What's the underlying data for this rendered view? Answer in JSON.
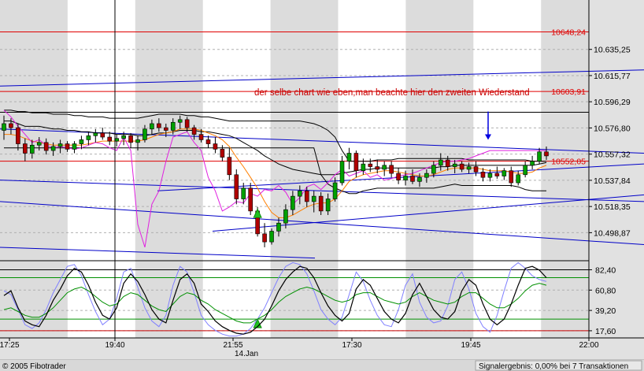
{
  "chart_data": {
    "type": "candlestick",
    "title": "",
    "annotation": "der selbe chart wie eben,man beachte hier den zweiten Wiederstand",
    "price_panel": {
      "ylim": [
        10478,
        10672
      ],
      "y_ticks": [
        "10.635,25",
        "10.615,77",
        "10.596,29",
        "10.576,80",
        "10.557,32",
        "10.537,84",
        "10.518,35",
        "10.498,87"
      ],
      "y_tick_values": [
        10635.25,
        10615.77,
        10596.29,
        10576.8,
        10557.32,
        10537.84,
        10518.35,
        10498.87
      ],
      "horizontal_levels": [
        {
          "label": "10648,24",
          "value": 10648.24,
          "color": "#e00000"
        },
        {
          "label": "10603,91",
          "value": 10603.91,
          "color": "#e00000"
        },
        {
          "label": "10552,05",
          "value": 10552.05,
          "color": "#e00000"
        },
        {
          "label": "",
          "value": 10588.5,
          "color": "#000000"
        }
      ],
      "candles_ohlc": [
        [
          10575,
          10586,
          10568,
          10580
        ],
        [
          10580,
          10584,
          10572,
          10577
        ],
        [
          10577,
          10580,
          10560,
          10565
        ],
        [
          10565,
          10569,
          10552,
          10558
        ],
        [
          10558,
          10568,
          10554,
          10564
        ],
        [
          10564,
          10570,
          10560,
          10566
        ],
        [
          10566,
          10569,
          10557,
          10560
        ],
        [
          10560,
          10566,
          10556,
          10563
        ],
        [
          10563,
          10568,
          10558,
          10565
        ],
        [
          10565,
          10567,
          10559,
          10561
        ],
        [
          10561,
          10567,
          10558,
          10565
        ],
        [
          10565,
          10571,
          10561,
          10568
        ],
        [
          10568,
          10574,
          10564,
          10571
        ],
        [
          10571,
          10576,
          10566,
          10573
        ],
        [
          10573,
          10577,
          10568,
          10570
        ],
        [
          10570,
          10574,
          10564,
          10567
        ],
        [
          10567,
          10572,
          10563,
          10569
        ],
        [
          10569,
          10574,
          10564,
          10571
        ],
        [
          10571,
          10573,
          10562,
          10566
        ],
        [
          10566,
          10571,
          10560,
          10568
        ],
        [
          10568,
          10579,
          10566,
          10576
        ],
        [
          10576,
          10583,
          10572,
          10580
        ],
        [
          10580,
          10584,
          10574,
          10577
        ],
        [
          10577,
          10580,
          10570,
          10575
        ],
        [
          10575,
          10584,
          10572,
          10581
        ],
        [
          10581,
          10586,
          10576,
          10583
        ],
        [
          10583,
          10585,
          10574,
          10577
        ],
        [
          10577,
          10579,
          10568,
          10572
        ],
        [
          10572,
          10576,
          10566,
          10568
        ],
        [
          10568,
          10571,
          10562,
          10565
        ],
        [
          10565,
          10570,
          10558,
          10561
        ],
        [
          10561,
          10564,
          10552,
          10555
        ],
        [
          10555,
          10562,
          10538,
          10542
        ],
        [
          10542,
          10546,
          10520,
          10524
        ],
        [
          10524,
          10536,
          10520,
          10532
        ],
        [
          10532,
          10536,
          10512,
          10515
        ],
        [
          10515,
          10518,
          10496,
          10498
        ],
        [
          10498,
          10506,
          10488,
          10492
        ],
        [
          10492,
          10502,
          10490,
          10500
        ],
        [
          10500,
          10510,
          10496,
          10506
        ],
        [
          10506,
          10520,
          10502,
          10516
        ],
        [
          10516,
          10530,
          10512,
          10526
        ],
        [
          10526,
          10534,
          10520,
          10530
        ],
        [
          10530,
          10533,
          10518,
          10522
        ],
        [
          10522,
          10530,
          10514,
          10526
        ],
        [
          10526,
          10529,
          10512,
          10515
        ],
        [
          10515,
          10528,
          10512,
          10524
        ],
        [
          10524,
          10540,
          10522,
          10536
        ],
        [
          10536,
          10556,
          10534,
          10552
        ],
        [
          10552,
          10562,
          10546,
          10558
        ],
        [
          10558,
          10560,
          10540,
          10545
        ],
        [
          10545,
          10554,
          10542,
          10550
        ],
        [
          10550,
          10554,
          10544,
          10548
        ],
        [
          10548,
          10553,
          10543,
          10546
        ],
        [
          10546,
          10552,
          10541,
          10549
        ],
        [
          10549,
          10552,
          10540,
          10543
        ],
        [
          10543,
          10547,
          10535,
          10538
        ],
        [
          10538,
          10545,
          10534,
          10541
        ],
        [
          10541,
          10546,
          10535,
          10537
        ],
        [
          10537,
          10543,
          10533,
          10540
        ],
        [
          10540,
          10546,
          10536,
          10543
        ],
        [
          10543,
          10552,
          10540,
          10549
        ],
        [
          10549,
          10558,
          10545,
          10553
        ],
        [
          10553,
          10556,
          10545,
          10548
        ],
        [
          10548,
          10553,
          10543,
          10550
        ],
        [
          10550,
          10552,
          10544,
          10546
        ],
        [
          10546,
          10551,
          10543,
          10548
        ],
        [
          10548,
          10552,
          10541,
          10544
        ],
        [
          10544,
          10547,
          10537,
          10540
        ],
        [
          10540,
          10546,
          10537,
          10543
        ],
        [
          10543,
          10548,
          10539,
          10541
        ],
        [
          10541,
          10547,
          10538,
          10545
        ],
        [
          10545,
          10548,
          10533,
          10536
        ],
        [
          10536,
          10545,
          10534,
          10542
        ],
        [
          10542,
          10552,
          10540,
          10549
        ],
        [
          10549,
          10556,
          10546,
          10552
        ],
        [
          10552,
          10562,
          10550,
          10559
        ],
        [
          10559,
          10563,
          10553,
          10556
        ]
      ],
      "moving_average_black": [
        10582,
        10582,
        10580,
        10578,
        10578,
        10578,
        10577,
        10576,
        10576,
        10575,
        10575,
        10574,
        10574,
        10573,
        10573,
        10573,
        10572,
        10572,
        10572,
        10571,
        10571,
        10572,
        10573,
        10573,
        10574,
        10575,
        10575,
        10575,
        10574,
        10574,
        10573,
        10572,
        10571,
        10569,
        10566,
        10563,
        10560,
        10556,
        10553,
        10550,
        10548,
        10546,
        10545,
        10544,
        10543,
        10542,
        10542,
        10542,
        10543,
        10544,
        10545,
        10546,
        10546,
        10547,
        10547,
        10547,
        10547,
        10547,
        10547,
        10547,
        10547,
        10547,
        10548,
        10548,
        10549,
        10549,
        10549,
        10549,
        10549,
        10549,
        10549,
        10549,
        10549,
        10549,
        10549,
        10549,
        10550,
        10551
      ],
      "envelope_black_upper": [
        10590,
        10590,
        10589,
        10589,
        10588,
        10588,
        10588,
        10587,
        10587,
        10587,
        10586,
        10586,
        10585,
        10585,
        10585,
        10584,
        10584,
        10584,
        10584,
        10584,
        10585,
        10586,
        10587,
        10587,
        10587,
        10587,
        10586,
        10586,
        10585,
        10585,
        10584,
        10583,
        10582,
        10582,
        10582,
        10582,
        10582,
        10582,
        10582,
        10582,
        10582,
        10582,
        10582,
        10581,
        10580,
        10578,
        10575,
        10570,
        10560,
        10552,
        10552,
        10552,
        10552,
        10553,
        10553,
        10553,
        10554,
        10554,
        10554,
        10554,
        10554,
        10554,
        10554,
        10554,
        10554,
        10554,
        10553,
        10553,
        10553,
        10553,
        10553,
        10553,
        10553,
        10553,
        10553,
        10552,
        10552,
        10552
      ],
      "envelope_black_lower": [
        10562,
        10562,
        10562,
        10562,
        10562,
        10562,
        10562,
        10562,
        10562,
        10562,
        10562,
        10562,
        10562,
        10562,
        10562,
        10562,
        10562,
        10562,
        10562,
        10562,
        10562,
        10562,
        10562,
        10562,
        10562,
        10562,
        10562,
        10562,
        10562,
        10562,
        10562,
        10562,
        10562,
        10562,
        10562,
        10562,
        10562,
        10562,
        10562,
        10562,
        10562,
        10562,
        10562,
        10562,
        10562,
        10542,
        10535,
        10532,
        10530,
        10528,
        10528,
        10530,
        10531,
        10532,
        10532,
        10532,
        10532,
        10532,
        10532,
        10532,
        10532,
        10532,
        10533,
        10534,
        10535,
        10534,
        10534,
        10534,
        10534,
        10534,
        10534,
        10534,
        10534,
        10533,
        10531,
        10530,
        10530,
        10530
      ],
      "moving_average_orange": [
        10572,
        10572,
        10571,
        10569,
        10567,
        10566,
        10565,
        10564,
        10564,
        10564,
        10564,
        10564,
        10565,
        10566,
        10567,
        10567,
        10567,
        10567,
        10567,
        10567,
        10568,
        10570,
        10572,
        10573,
        10574,
        10576,
        10576,
        10576,
        10575,
        10573,
        10571,
        10568,
        10563,
        10555,
        10548,
        10540,
        10532,
        10522,
        10514,
        10510,
        10510,
        10512,
        10515,
        10518,
        10520,
        10521,
        10521,
        10524,
        10530,
        10537,
        10540,
        10542,
        10543,
        10544,
        10545,
        10545,
        10544,
        10543,
        10542,
        10541,
        10541,
        10542,
        10544,
        10546,
        10547,
        10547,
        10547,
        10547,
        10546,
        10545,
        10545,
        10545,
        10544,
        10543,
        10543,
        10544,
        10547,
        10549
      ],
      "indicator_magenta": [
        10590,
        10585,
        10578,
        10572,
        10566,
        10568,
        10564,
        10562,
        10563,
        10562,
        10561,
        10562,
        10564,
        10566,
        10565,
        10562,
        10560,
        10570,
        10560,
        10505,
        10488,
        10520,
        10530,
        10552,
        10570,
        10572,
        10574,
        10566,
        10560,
        10540,
        10530,
        10515,
        10518,
        10522,
        10521,
        10528,
        10526,
        10531,
        10530,
        10534,
        10529,
        10520,
        10525,
        10533,
        10535,
        10531,
        10536,
        10542,
        10546,
        10541,
        10543,
        10545,
        10540,
        10542,
        10538,
        10539,
        10541,
        10542,
        10543,
        10545,
        10547,
        10549,
        10551,
        10552,
        10552,
        10553,
        10554,
        10556,
        10558,
        10560,
        10560,
        10560,
        10560,
        10560,
        10560,
        10560,
        10560,
        10560
      ],
      "trend_lines": [
        {
          "color": "#0000c8",
          "points": [
            [
              0,
              10608
            ],
            [
              818,
              10620
            ]
          ]
        },
        {
          "color": "#0000c8",
          "points": [
            [
              0,
              10576
            ],
            [
              818,
              10558
            ]
          ]
        },
        {
          "color": "#0000c8",
          "points": [
            [
              0,
              10522
            ],
            [
              818,
              10490
            ]
          ]
        },
        {
          "color": "#0000c8",
          "points": [
            [
              0,
              10538
            ],
            [
              818,
              10522
            ]
          ]
        },
        {
          "color": "#0000c8",
          "points": [
            [
              200,
              10530
            ],
            [
              818,
              10550
            ]
          ]
        },
        {
          "color": "#0000c8",
          "points": [
            [
              270,
              10500
            ],
            [
              818,
              10527
            ]
          ]
        },
        {
          "color": "#0000c8",
          "points": [
            [
              0,
              10488
            ],
            [
              400,
              10480
            ]
          ]
        }
      ],
      "buy_markers": [
        {
          "index": 36,
          "value": 10513
        }
      ],
      "arrow_down": {
        "x_tick": "19:45",
        "from": 10589,
        "to": 10568
      }
    },
    "oscillator_panel": {
      "ylim": [
        10,
        92
      ],
      "y_ticks": [
        "82,40",
        "60,80",
        "39,20",
        "17,60"
      ],
      "y_tick_values": [
        82.4,
        60.8,
        39.2,
        17.6
      ],
      "levels": [
        {
          "value": 74,
          "color": "#009000"
        },
        {
          "value": 30,
          "color": "#009000"
        },
        {
          "value": 82.4,
          "color": "#000000"
        },
        {
          "value": 17.6,
          "color": "#c80000"
        }
      ],
      "series_black": [
        55,
        60,
        42,
        28,
        24,
        22,
        34,
        50,
        62,
        76,
        84,
        80,
        66,
        48,
        34,
        30,
        42,
        68,
        78,
        70,
        56,
        40,
        30,
        26,
        50,
        72,
        78,
        68,
        46,
        38,
        28,
        22,
        18,
        15,
        14,
        16,
        22,
        30,
        44,
        60,
        72,
        80,
        86,
        84,
        74,
        58,
        44,
        34,
        28,
        36,
        62,
        72,
        66,
        52,
        38,
        30,
        26,
        36,
        56,
        68,
        54,
        40,
        32,
        30,
        38,
        60,
        72,
        66,
        46,
        30,
        24,
        30,
        46,
        66,
        84,
        86,
        82,
        74
      ],
      "series_green": [
        40,
        42,
        38,
        34,
        32,
        32,
        36,
        42,
        50,
        58,
        62,
        64,
        60,
        54,
        48,
        44,
        46,
        54,
        58,
        56,
        50,
        44,
        40,
        38,
        46,
        54,
        58,
        56,
        50,
        46,
        40,
        36,
        32,
        28,
        26,
        26,
        30,
        34,
        40,
        48,
        54,
        58,
        62,
        64,
        62,
        58,
        54,
        50,
        48,
        50,
        56,
        58,
        58,
        54,
        50,
        48,
        46,
        48,
        54,
        58,
        54,
        50,
        48,
        46,
        48,
        54,
        58,
        58,
        52,
        46,
        42,
        42,
        46,
        52,
        60,
        66,
        68,
        66
      ],
      "series_lightblue": [
        60,
        56,
        40,
        24,
        20,
        26,
        40,
        58,
        72,
        86,
        88,
        76,
        56,
        38,
        24,
        30,
        52,
        80,
        84,
        64,
        42,
        28,
        22,
        34,
        66,
        86,
        80,
        58,
        34,
        24,
        18,
        14,
        12,
        12,
        14,
        20,
        30,
        42,
        58,
        74,
        86,
        90,
        88,
        78,
        60,
        40,
        30,
        24,
        32,
        56,
        80,
        70,
        50,
        34,
        24,
        22,
        40,
        66,
        78,
        48,
        32,
        26,
        28,
        44,
        72,
        80,
        62,
        36,
        22,
        16,
        34,
        60,
        84,
        90,
        84,
        76,
        72,
        70
      ],
      "buy_markers": [
        {
          "index": 36,
          "value": 25
        }
      ]
    },
    "x_ticks": [
      "17:25",
      "19:40",
      "21:55",
      "17:30",
      "19:45",
      "22:00"
    ],
    "x_date_label": "14.Jan",
    "footer_left": "© 2005 Fibotrader",
    "footer_right": "Signalergebnis: 0,00% bei 7 Transaktionen"
  }
}
